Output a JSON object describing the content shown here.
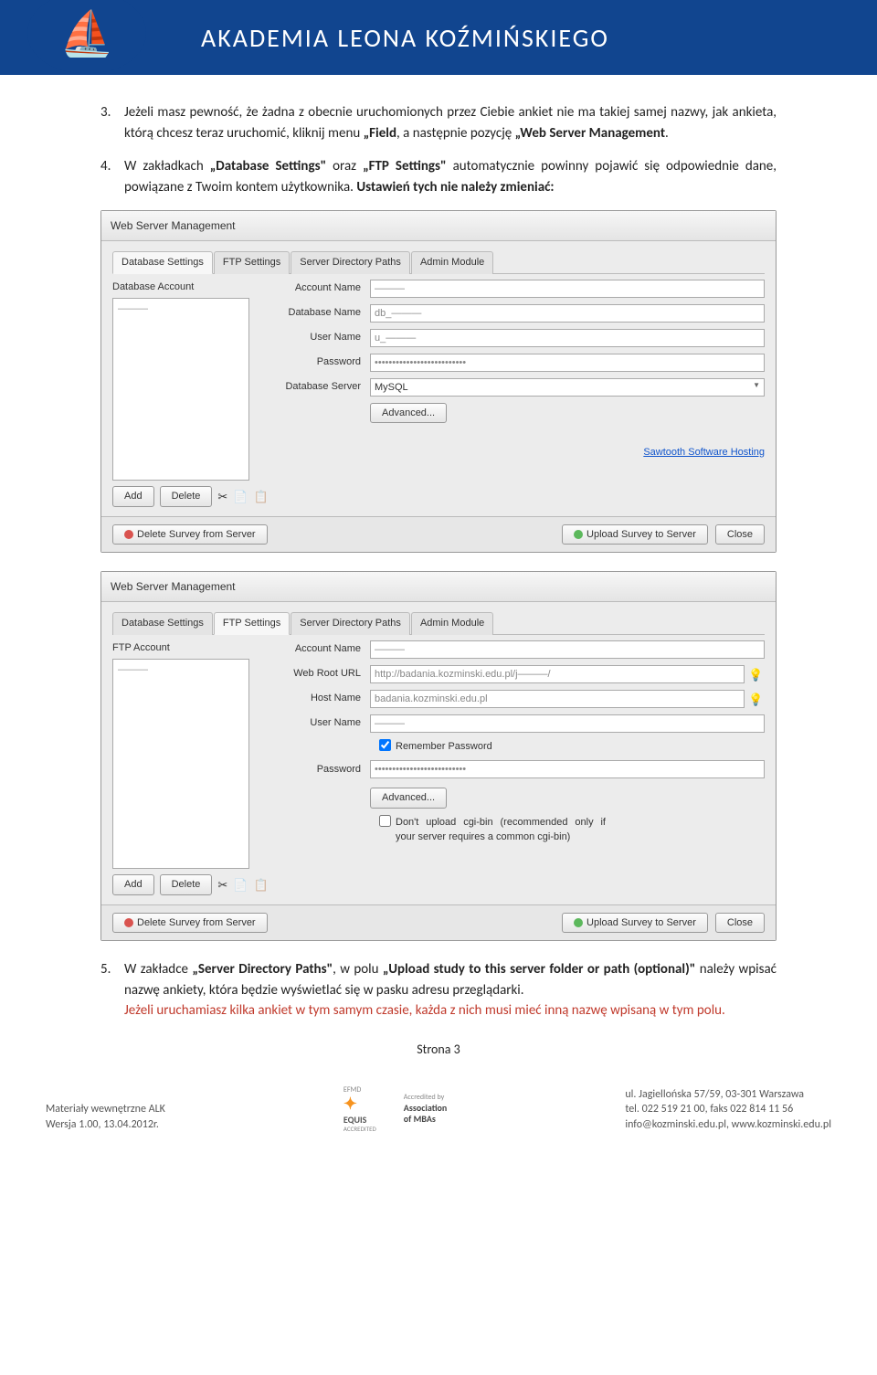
{
  "header": {
    "title": "AKADEMIA LEONA KOŹMIŃSKIEGO"
  },
  "para3": {
    "num": "3.",
    "t1": "Jeżeli masz pewność, że żadna z obecnie uruchomionych przez Ciebie ankiet nie ma takiej samej nazwy, jak ankieta, którą chcesz teraz uruchomić, kliknij menu ",
    "b1": "„Field",
    "t2": ", a następnie pozycję ",
    "b2": "„Web Server Management",
    "t3": "."
  },
  "para4": {
    "num": "4.",
    "t1": "W zakładkach ",
    "b1": "„Database Settings\"",
    "t2": " oraz ",
    "b2": "„FTP Settings\"",
    "t3": " automatycznie powinny pojawić się odpowiednie dane, powiązane z Twoim kontem użytkownika. ",
    "b3": "Ustawień tych nie należy zmieniać:"
  },
  "dialog1": {
    "title": "Web Server Management",
    "tabs": [
      "Database Settings",
      "FTP Settings",
      "Server Directory Paths",
      "Admin Module"
    ],
    "group": "Database Account",
    "listItem": "———",
    "fields": {
      "accountName": {
        "label": "Account Name",
        "value": "———"
      },
      "dbName": {
        "label": "Database Name",
        "value": "db_———"
      },
      "userName": {
        "label": "User Name",
        "value": "u_———"
      },
      "password": {
        "label": "Password",
        "value": "••••••••••••••••••••••••••"
      },
      "dbServer": {
        "label": "Database Server",
        "value": "MySQL"
      }
    },
    "advanced": "Advanced...",
    "hostingLink": "Sawtooth Software Hosting",
    "buttons": {
      "add": "Add",
      "delete": "Delete",
      "deleteFromServer": "Delete Survey from Server",
      "upload": "Upload Survey to Server",
      "close": "Close"
    }
  },
  "dialog2": {
    "title": "Web Server Management",
    "tabs": [
      "Database Settings",
      "FTP Settings",
      "Server Directory Paths",
      "Admin Module"
    ],
    "group": "FTP Account",
    "listItem": "———",
    "fields": {
      "accountName": {
        "label": "Account Name",
        "value": "———"
      },
      "webRoot": {
        "label": "Web Root URL",
        "value": "http://badania.kozminski.edu.pl/j———/"
      },
      "hostName": {
        "label": "Host Name",
        "value": "badania.kozminski.edu.pl"
      },
      "userName": {
        "label": "User Name",
        "value": "———"
      },
      "remember": {
        "label": "Remember Password"
      },
      "password": {
        "label": "Password",
        "value": "••••••••••••••••••••••••••"
      }
    },
    "advanced": "Advanced...",
    "cgiNote": "Don't upload cgi-bin (recommended only if your server requires a common cgi-bin)",
    "buttons": {
      "add": "Add",
      "delete": "Delete",
      "deleteFromServer": "Delete Survey from Server",
      "upload": "Upload Survey to Server",
      "close": "Close"
    }
  },
  "para5": {
    "num": "5.",
    "t1": "W zakładce ",
    "b1": "„Server Directory Paths\"",
    "t2": ", w polu ",
    "b2": "„Upload study to this server folder or path (optional)\"",
    "t3": " należy wpisać nazwę ankiety, która będzie wyświetlać się w pasku adresu przeglądarki.",
    "red": "Jeżeli uruchamiasz kilka ankiet w tym samym czasie, każda z nich musi mieć inną nazwę wpisaną w tym polu."
  },
  "pageNum": "Strona 3",
  "footer": {
    "left1": "Materiały wewnętrzne ALK",
    "left2": "Wersja 1.00, 13.04.2012r.",
    "accr1a": "EFMD",
    "accr1b": "EQUIS",
    "accr1c": "ACCREDITED",
    "accr2a": "Accredited by",
    "accr2b": "Association",
    "accr2c": "of MBAs",
    "r1": "ul. Jagiellońska 57/59, 03-301 Warszawa",
    "r2": "tel. 022 519 21 00, faks 022 814 11 56",
    "r3": "info@kozminski.edu.pl, www.kozminski.edu.pl"
  }
}
